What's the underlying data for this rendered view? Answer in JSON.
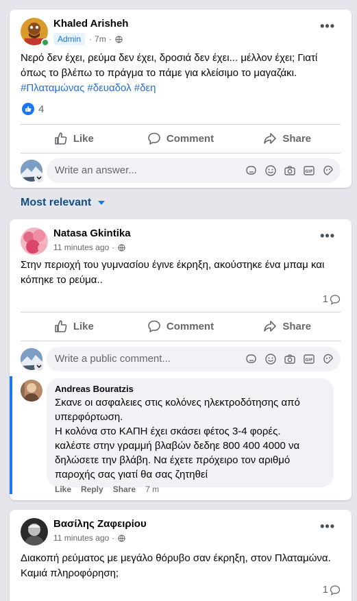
{
  "post": {
    "author": "Khaled Arisheh",
    "badge": "Admin",
    "time": "7m",
    "separator": "·",
    "text": "Νερό δεν έχει, ρεύμα δεν έχει, δροσιά δεν έχει... μέλλον έχει; Γιατί όπως το βλέπω το πράγμα το πάμε για κλείσιμο το μαγαζάκι.",
    "hashtags": "#Πλαταμώνας #δευαδολ #δεη",
    "reactions": "4",
    "actions": {
      "like": "Like",
      "comment": "Comment",
      "share": "Share"
    },
    "composer_placeholder": "Write an answer...",
    "more": "•••"
  },
  "filter": {
    "label": "Most relevant"
  },
  "comments": [
    {
      "author": "Natasa Gkintika",
      "time": "11 minutes ago",
      "text": "Στην περιοχή του γυμνασίου έγινε έκρηξη, ακούστηκε ένα μπαμ και κόπηκε το ρεύμα..",
      "comment_count": "1",
      "actions": {
        "like": "Like",
        "comment": "Comment",
        "share": "Share"
      },
      "composer_placeholder": "Write a public comment...",
      "reply": {
        "author": "Andreas Bouratzis",
        "text": "Σκανε οι ασφαλειες στις κολόνες ηλεκτροδότησης από υπερφόρτωση.\nΗ κολόνα στο ΚΑΠΗ έχει σκάσει φέτος 3-4 φορές.\nκαλέστε στην γραμμή βλαβών δεδηε 800 400 4000 να δηλώσετε την βλάβη. Να έχετε πρόχειρο τον αριθμό παροχής σας γιατί θα σας ζητηθεί",
        "like": "Like",
        "reply": "Reply",
        "share": "Share",
        "time": "7 m"
      }
    },
    {
      "author": "Βασίλης Ζαφειρίου",
      "time": "11 minutes ago",
      "text": "Διακοπή ρεύματος με μεγάλο θόρυβο σαν έκρηξη, στον Πλαταμώνα. Καμιά πληροφόρηση;",
      "comment_count": "1"
    }
  ],
  "colors": {
    "accent": "#1877f2",
    "link": "#216fdb",
    "filter": "#124e85",
    "muted": "#65676b"
  }
}
